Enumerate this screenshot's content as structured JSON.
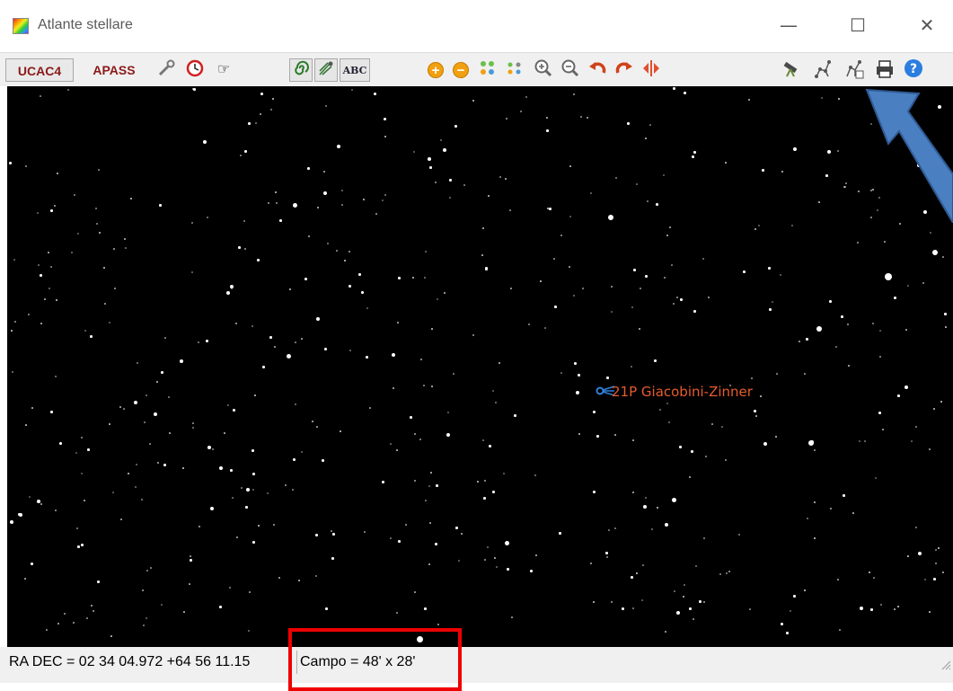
{
  "window": {
    "title": "Atlante stellare",
    "minimize_glyph": "—",
    "maximize_glyph": "☐",
    "close_glyph": "✕"
  },
  "toolbar": {
    "ucac4_label": "UCAC4",
    "apass_label": "APASS",
    "abc_label": "ABC",
    "icons": [
      "wrench-icon",
      "clock-icon",
      "pointing-hand-icon",
      "spiral-galaxy-icon",
      "comet-icon",
      "abc-labels-icon",
      "zoom-in-circle-icon",
      "zoom-out-circle-icon",
      "bigger-stars-icon",
      "smaller-stars-icon",
      "magnify-plus-icon",
      "magnify-minus-icon",
      "rotate-left-icon",
      "rotate-right-icon",
      "flip-icon",
      "telescope-icon",
      "constellation-icon",
      "constellation-settings-icon",
      "printer-icon",
      "help-icon"
    ]
  },
  "sky": {
    "object_label": "21P Giacobini-Zinner",
    "label_color": "#e65c2e",
    "comet_icon_color": "#2f7fd8"
  },
  "status": {
    "radec": "RA DEC  =  02 34 04.972 +64 56 11.15",
    "campo": "Campo  =  48' x 28'"
  },
  "annotations": {
    "highlight_color": "#ee0000",
    "arrow_color": "#4a7fc1"
  }
}
